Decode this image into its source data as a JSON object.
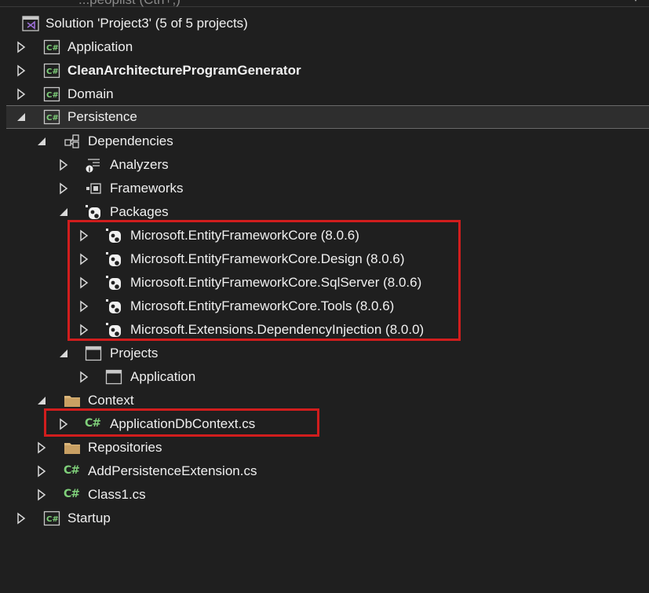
{
  "top_strip": {
    "partial_text": "...peoplist (Ctrl+;)"
  },
  "tree": {
    "solution_label": "Solution 'Project3' (5 of 5 projects)",
    "projects": [
      {
        "label": "Application",
        "bold": false
      },
      {
        "label": "CleanArchitectureProgramGenerator",
        "bold": true
      },
      {
        "label": "Domain",
        "bold": false
      },
      {
        "label": "Persistence",
        "bold": false,
        "selected": true
      },
      {
        "label": "Startup",
        "bold": false
      }
    ],
    "dependencies_label": "Dependencies",
    "analyzers_label": "Analyzers",
    "frameworks_label": "Frameworks",
    "packages_label": "Packages",
    "packages": [
      "Microsoft.EntityFrameworkCore (8.0.6)",
      "Microsoft.EntityFrameworkCore.Design (8.0.6)",
      "Microsoft.EntityFrameworkCore.SqlServer (8.0.6)",
      "Microsoft.EntityFrameworkCore.Tools (8.0.6)",
      "Microsoft.Extensions.DependencyInjection (8.0.0)"
    ],
    "projects_ref_label": "Projects",
    "project_ref_application": "Application",
    "context_folder_label": "Context",
    "context_file_label": "ApplicationDbContext.cs",
    "repositories_label": "Repositories",
    "add_persistence_file_label": "AddPersistenceExtension.cs",
    "class1_file_label": "Class1.cs"
  },
  "colors": {
    "background": "#1f1f1f",
    "selected_background": "#2e2e2e",
    "highlight_red": "#d11d1d",
    "csharp_green": "#7fd07a",
    "folder_yellow": "#dcb67a",
    "vs_purple": "#9b6fd6"
  },
  "icons": {
    "solution": "visual-studio-solution-icon",
    "csproj": "csharp-project-icon",
    "dependencies": "dependencies-icon",
    "analyzers": "analyzers-icon",
    "frameworks": "frameworks-icon",
    "package": "nuget-package-icon",
    "projects_ref": "project-reference-icon",
    "folder": "folder-icon",
    "csfile": "csharp-file-icon",
    "collapsed": "expand-triangle-icon",
    "expanded": "collapse-triangle-icon"
  }
}
